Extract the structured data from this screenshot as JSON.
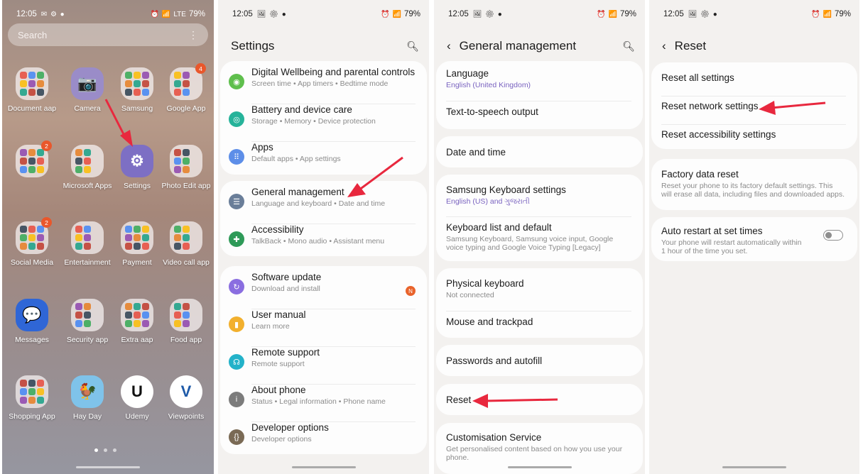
{
  "status": {
    "time": "12:05",
    "battery": "79%",
    "network": "LTE"
  },
  "colors": {
    "arrow": "#e8283e",
    "accent_purple": "#7a63c0",
    "badge": "#e9572b"
  },
  "home": {
    "search_placeholder": "Search",
    "apps": [
      {
        "label": "Document aap",
        "icon": "folder-icon"
      },
      {
        "label": "Camera",
        "icon": "camera-icon"
      },
      {
        "label": "Samsung",
        "icon": "folder-icon"
      },
      {
        "label": "Google App",
        "icon": "folder-icon",
        "badge": "4"
      },
      {
        "label": "",
        "icon": "folder-icon",
        "badge": "2"
      },
      {
        "label": "Microsoft Apps",
        "icon": "folder-icon"
      },
      {
        "label": "Settings",
        "icon": "gear-icon"
      },
      {
        "label": "Photo Edit app",
        "icon": "folder-icon"
      },
      {
        "label": "Social Media",
        "icon": "folder-icon",
        "badge": "2"
      },
      {
        "label": "Entertainment",
        "icon": "folder-icon"
      },
      {
        "label": "Payment",
        "icon": "folder-icon"
      },
      {
        "label": "Video call app",
        "icon": "folder-icon"
      },
      {
        "label": "Messages",
        "icon": "message-icon"
      },
      {
        "label": "Security  app",
        "icon": "folder-icon"
      },
      {
        "label": "Extra aap",
        "icon": "folder-icon"
      },
      {
        "label": "Food app",
        "icon": "folder-icon"
      },
      {
        "label": "Shopping App",
        "icon": "folder-icon"
      },
      {
        "label": "Hay Day",
        "icon": "rooster-icon"
      },
      {
        "label": "Udemy",
        "icon": "udemy-icon"
      },
      {
        "label": "Viewpoints",
        "icon": "viewpoints-icon"
      }
    ]
  },
  "settings": {
    "title": "Settings",
    "items": [
      {
        "title": "Digital Wellbeing and parental controls",
        "sub": "Screen time  •  App timers  •  Bedtime mode",
        "icon": "wellbeing-icon"
      },
      {
        "title": "Battery and device care",
        "sub": "Storage  •  Memory  •  Device protection",
        "icon": "battery-care-icon"
      },
      {
        "title": "Apps",
        "sub": "Default apps  •  App settings",
        "icon": "apps-icon"
      },
      {
        "title": "General management",
        "sub": "Language and keyboard  •  Date and time",
        "icon": "sliders-icon"
      },
      {
        "title": "Accessibility",
        "sub": "TalkBack  •  Mono audio  •  Assistant menu",
        "icon": "accessibility-icon"
      },
      {
        "title": "Software update",
        "sub": "Download and install",
        "icon": "update-icon",
        "badge": "N"
      },
      {
        "title": "User manual",
        "sub": "Learn more",
        "icon": "manual-icon"
      },
      {
        "title": "Remote support",
        "sub": "Remote support",
        "icon": "headset-icon"
      },
      {
        "title": "About phone",
        "sub": "Status  •  Legal information  •  Phone name",
        "icon": "info-icon"
      },
      {
        "title": "Developer options",
        "sub": "Developer options",
        "icon": "developer-icon"
      }
    ]
  },
  "general": {
    "title": "General management",
    "items": [
      {
        "title": "Language",
        "sub": "English (United Kingdom)"
      },
      {
        "title": "Text-to-speech output",
        "sub": ""
      },
      {
        "title": "Date and time",
        "sub": ""
      },
      {
        "title": "Samsung Keyboard settings",
        "sub": "English (US) and ગુજરાતી"
      },
      {
        "title": "Keyboard list and default",
        "sub": "Samsung Keyboard, Samsung voice input, Google voice typing and Google Voice Typing [Legacy]"
      },
      {
        "title": "Physical keyboard",
        "sub": "Not connected"
      },
      {
        "title": "Mouse and trackpad",
        "sub": ""
      },
      {
        "title": "Passwords and autofill",
        "sub": ""
      },
      {
        "title": "Reset",
        "sub": ""
      },
      {
        "title": "Customisation Service",
        "sub": "Get personalised content based on how you use your phone."
      }
    ]
  },
  "reset": {
    "title": "Reset",
    "items": [
      {
        "title": "Reset all settings",
        "sub": ""
      },
      {
        "title": "Reset network settings",
        "sub": ""
      },
      {
        "title": "Reset accessibility settings",
        "sub": ""
      },
      {
        "title": "Factory data reset",
        "sub": "Reset your phone to its factory default settings. This will erase all data, including files and downloaded apps."
      },
      {
        "title": "Auto restart at set times",
        "sub": "Your phone will restart automatically within 1 hour of the time you set.",
        "toggle_on": false
      }
    ]
  }
}
